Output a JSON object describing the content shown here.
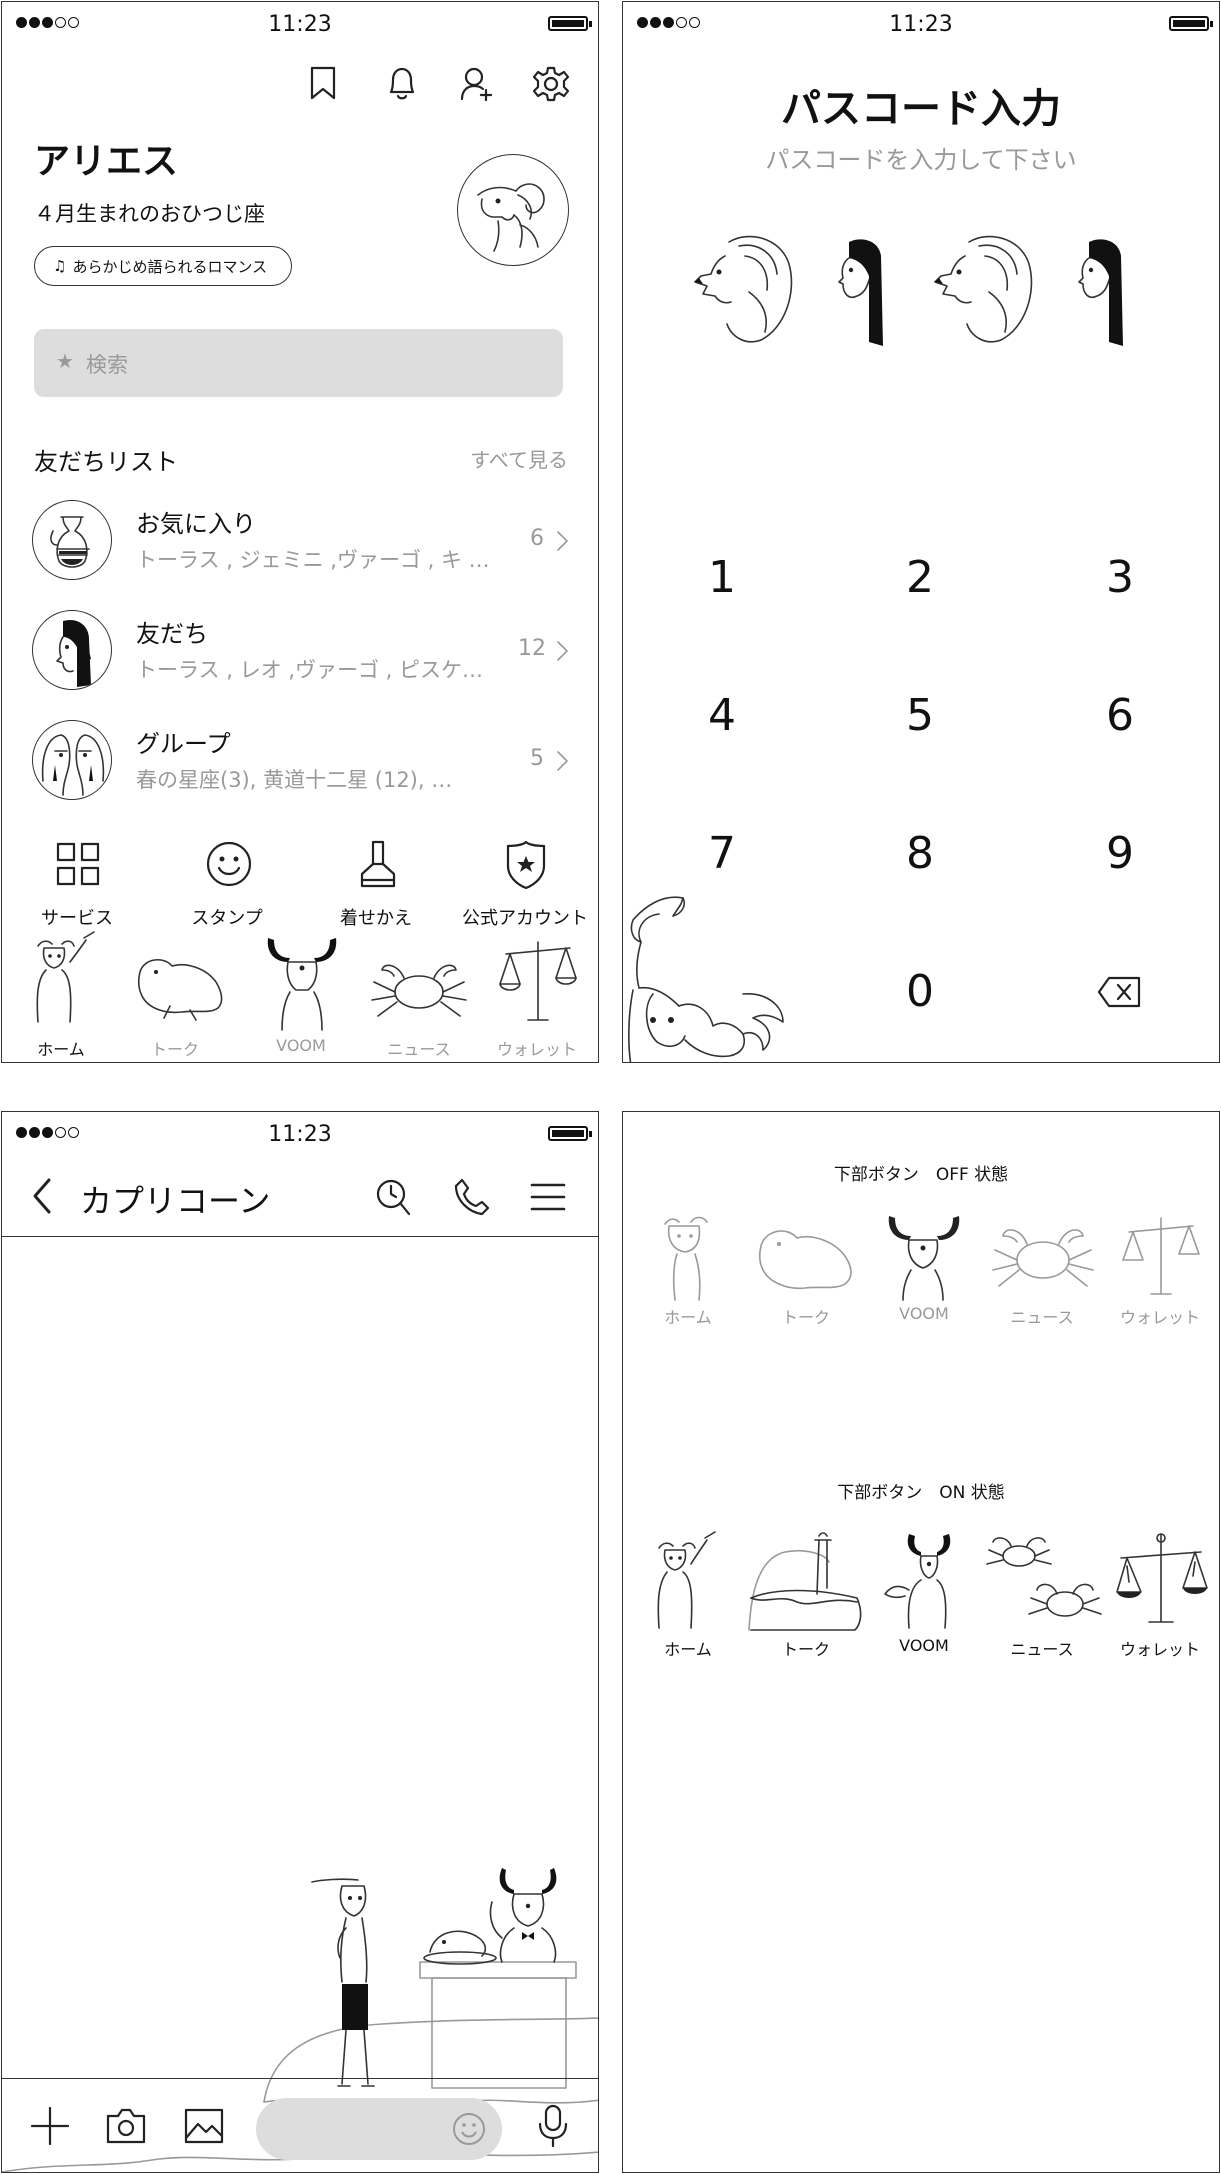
{
  "status": {
    "time": "11:23"
  },
  "home": {
    "title": "アリエス",
    "subtitle": "４月生まれのおひつじ座",
    "music_label": "あらかじめ語られるロマンス",
    "search_placeholder": "検索",
    "friends_header": "友だちリスト",
    "see_all": "すべて見る",
    "rows": [
      {
        "title": "お気に入り",
        "sub": "トーラス , ジェミニ ,ヴァーゴ , キ …",
        "count": "6"
      },
      {
        "title": "友だち",
        "sub": "トーラス , レオ ,ヴァーゴ , ピスケ…",
        "count": "12"
      },
      {
        "title": "グループ",
        "sub": "春の星座(3), 黄道十二星 (12), …",
        "count": "5"
      }
    ],
    "shortcuts": [
      "サービス",
      "スタンプ",
      "着せかえ",
      "公式アカウント"
    ],
    "tabs": [
      "ホーム",
      "トーク",
      "VOOM",
      "ニュース",
      "ウォレット"
    ]
  },
  "passcode": {
    "title": "パスコード入力",
    "subtitle": "パスコードを入力して下さい",
    "keys": [
      "1",
      "2",
      "3",
      "4",
      "5",
      "6",
      "7",
      "8",
      "9",
      "0"
    ]
  },
  "chat": {
    "title": "カプリコーン"
  },
  "tabstates": {
    "off_label": "下部ボタン　OFF 状態",
    "on_label": "下部ボタン　ON 状態",
    "tabs": [
      "ホーム",
      "トーク",
      "VOOM",
      "ニュース",
      "ウォレット"
    ]
  },
  "colors": {
    "line": "#222222",
    "muted": "#999999",
    "search_bg": "#dddddd"
  }
}
